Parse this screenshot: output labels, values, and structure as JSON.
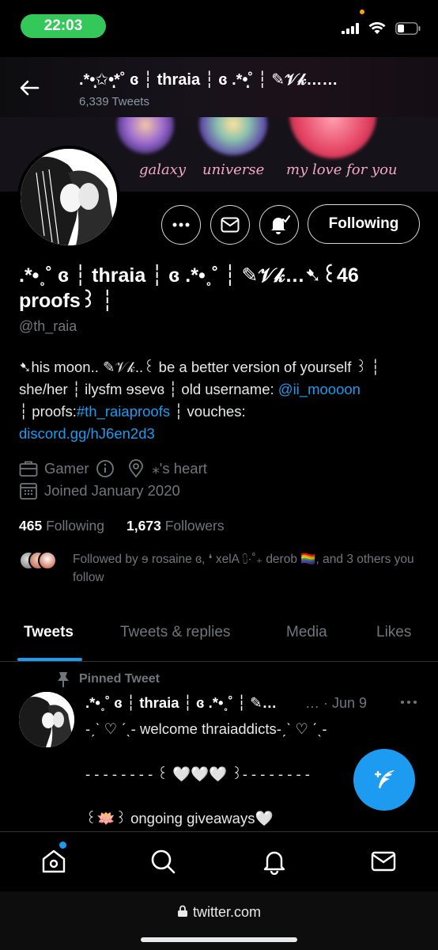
{
  "status_bar": {
    "time": "22:03",
    "icons": [
      "signal-icon",
      "wifi-icon",
      "battery-icon"
    ]
  },
  "header": {
    "title": ".*•̩̩͙✩•̩̩͙*˚ ɞ ┆ thraia ┆ ɞ .*•̩̩͙˚ ┆ ✎𝒱𝓀……",
    "tweet_count": "6,339 Tweets"
  },
  "banner": {
    "words": [
      "galaxy",
      "universe",
      "my love for you"
    ]
  },
  "actions": {
    "more_icon": "more-icon",
    "message_icon": "envelope-icon",
    "notify_icon": "bell-check-icon",
    "following_label": "Following"
  },
  "profile": {
    "name_line1": ".*•˳˚ ɞ ┆ thraia ┆ ɞ .*•˳˚ ┆ ✎𝒱𝓀…➷꒰46",
    "name_line2": "proofs꒱ ┆",
    "handle": "@th_raia",
    "bio": {
      "line1": "➷his moon.. ✎𝒱𝓀..꒰ be a better version of yourself ꒱ ┆",
      "line2_pre": "she/her ┆ ilysfm ɘsevɞ ┆ old username: ",
      "line2_link": "@ii_moooon",
      "line3_pre": "┆ proofs:",
      "line3_link": "#th_raiaproofs",
      "line3_post": " ┆ vouches:",
      "line4_link": "discord.gg/hJ6en2d3"
    },
    "category": "Gamer",
    "location": "⁎'s heart",
    "joined": "Joined January 2020",
    "following_count": "465",
    "following_label": "Following",
    "followers_count": "1,673",
    "followers_label": "Followers",
    "followed_by": "Followed by ɘ rosaine ɞ, ❛ xelA ⩇·˚₊ derob 🏳️‍🌈, and 3 others you follow"
  },
  "tabs": [
    {
      "label": "Tweets",
      "active": true
    },
    {
      "label": "Tweets & replies",
      "active": false
    },
    {
      "label": "Media",
      "active": false
    },
    {
      "label": "Likes",
      "active": false
    }
  ],
  "tweet": {
    "pinned_label": "Pinned Tweet",
    "author": ".*•˳˚ ɞ ┆ thraia ┆ ɞ .*•˳˚ ┆ ✎…",
    "date": "… · Jun 9",
    "line1": "-ˏˋ ♡ ˊˎ- welcome thraiaddicts-ˏˋ ♡ ˊˎ-",
    "line2": "- - - - - - - - ꒰ 🤍🤍🤍 ꒱- - - - - - - -",
    "line3": "꒰🪷꒱ ongoing giveaways🤍"
  },
  "compose_icon": "compose-feather-icon",
  "bottom_nav": [
    "home-icon",
    "search-icon",
    "notifications-icon",
    "messages-icon"
  ],
  "browser": {
    "url": "twitter.com"
  },
  "colors": {
    "accent": "#1d9bf0",
    "background": "#000000",
    "secondary_text": "#71767b",
    "status_time": "#34c759"
  }
}
